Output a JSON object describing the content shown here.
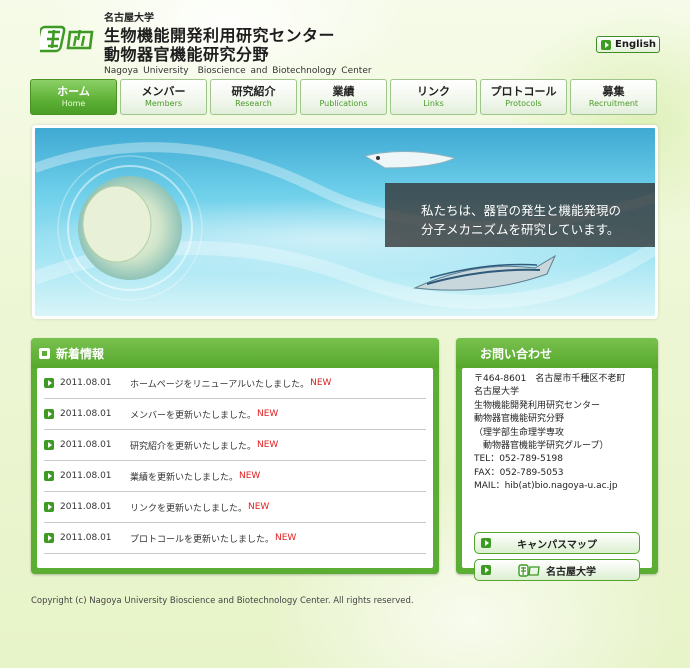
{
  "header": {
    "university_small": "名古屋大学",
    "title_line1": "生物機能開発利用研究センター",
    "title_line2": "動物器官機能研究分野",
    "title_en": "Nagoya University　Bioscience and Biotechnology Center",
    "english_label": "English"
  },
  "nav": [
    {
      "jp": "ホーム",
      "en": "Home",
      "active": true
    },
    {
      "jp": "メンバー",
      "en": "Members"
    },
    {
      "jp": "研究紹介",
      "en": "Research"
    },
    {
      "jp": "業績",
      "en": "Publications"
    },
    {
      "jp": "リンク",
      "en": "Links"
    },
    {
      "jp": "プロトコール",
      "en": "Protocols"
    },
    {
      "jp": "募集",
      "en": "Recruitment"
    }
  ],
  "hero": {
    "caption_line1": "私たちは、器官の発生と機能発現の",
    "caption_line2": "分子メカニズムを研究しています。"
  },
  "news": {
    "title": "新着情報",
    "new_label": "NEW",
    "items": [
      {
        "date": "2011.08.01",
        "text": "ホームページをリニューアルいたしました。"
      },
      {
        "date": "2011.08.01",
        "text": "メンバーを更新いたしました。"
      },
      {
        "date": "2011.08.01",
        "text": "研究紹介を更新いたしました。"
      },
      {
        "date": "2011.08.01",
        "text": "業績を更新いたしました。"
      },
      {
        "date": "2011.08.01",
        "text": "リンクを更新いたしました。"
      },
      {
        "date": "2011.08.01",
        "text": "プロトコールを更新いたしました。"
      }
    ]
  },
  "contact": {
    "title": "お問い合わせ",
    "lines": [
      "〒464-8601　名古屋市千種区不老町",
      "名古屋大学",
      "生物機能開発利用研究センター",
      "動物器官機能研究分野",
      "（理学部生命理学専攻",
      "　動物器官機能学研究グループ）",
      "TEL：052-789-5198",
      "FAX：052-789-5053",
      "MAIL：hib(at)bio.nagoya-u.ac.jp"
    ],
    "campus_map_label": "キャンパスマップ",
    "nagoya_univ_label": "名古屋大学"
  },
  "footer": {
    "copyright": "Copyright (c) Nagoya University Bioscience and Biotechnology Center. All rights reserved."
  },
  "colors": {
    "accent_green": "#5cad33",
    "new_red": "#e02020"
  }
}
